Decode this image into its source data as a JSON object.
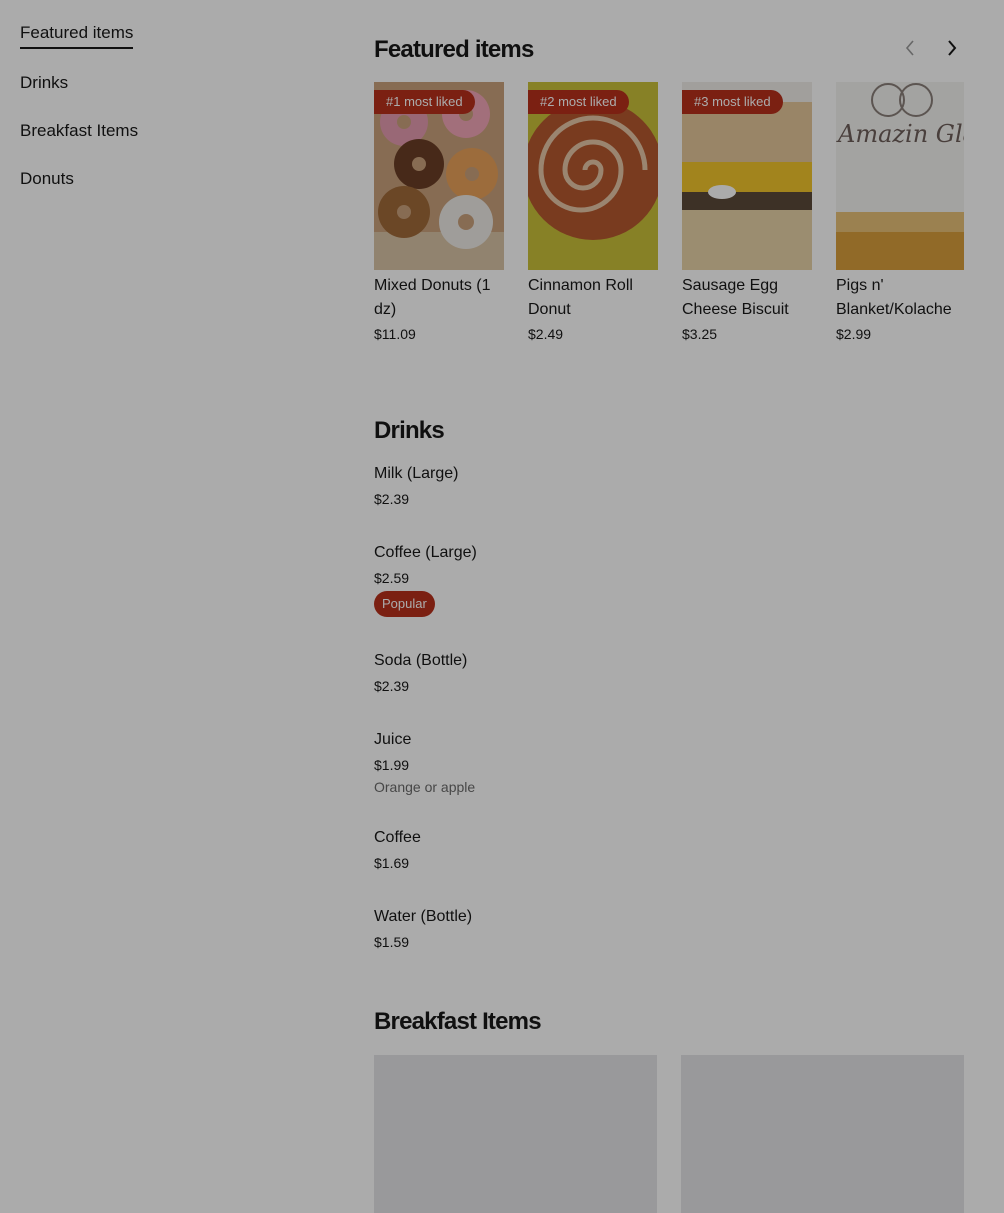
{
  "sidebar": {
    "items": [
      {
        "label": "Featured items",
        "active": true
      },
      {
        "label": "Drinks"
      },
      {
        "label": "Breakfast Items"
      },
      {
        "label": "Donuts"
      }
    ]
  },
  "featured": {
    "title": "Featured items",
    "nav": {
      "prev_icon": "chevron-left-icon",
      "next_icon": "chevron-right-icon"
    },
    "cards": [
      {
        "badge": "#1 most liked",
        "name": "Mixed Donuts (1 dz)",
        "price": "$11.09"
      },
      {
        "badge": "#2 most liked",
        "name": "Cinnamon Roll Donut",
        "price": "$2.49"
      },
      {
        "badge": "#3 most liked",
        "name": "Sausage Egg Cheese Biscuit",
        "price": "$3.25"
      },
      {
        "badge": "",
        "name": "Pigs n' Blanket/Kolache",
        "price": "$2.99",
        "image_text": "Amazin Glaze"
      }
    ]
  },
  "drinks": {
    "title": "Drinks",
    "items": [
      {
        "name": "Milk (Large)",
        "price": "$2.39"
      },
      {
        "name": "Coffee (Large)",
        "price": "$2.59",
        "badge": "Popular"
      },
      {
        "name": "Soda (Bottle)",
        "price": "$2.39"
      },
      {
        "name": "Juice",
        "price": "$1.99",
        "description": "Orange or apple"
      },
      {
        "name": "Coffee",
        "price": "$1.69"
      },
      {
        "name": "Water (Bottle)",
        "price": "$1.59"
      }
    ]
  },
  "breakfast": {
    "title": "Breakfast Items"
  },
  "colors": {
    "badge": "#b8301c",
    "overlay": "rgba(0,0,0,0.33)",
    "text": "#191919"
  }
}
